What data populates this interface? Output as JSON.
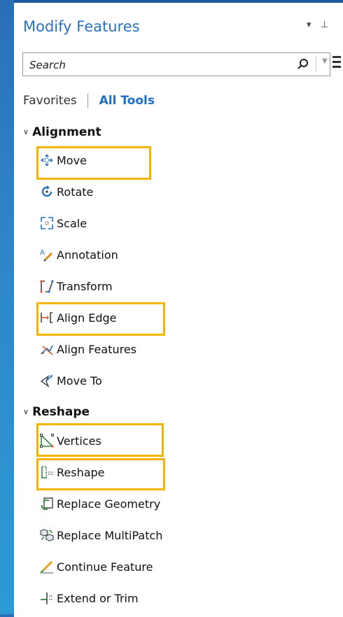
{
  "header": {
    "title": "Modify Features",
    "dropdown_glyph": "▾",
    "pin_glyph": "⊥"
  },
  "search": {
    "placeholder": "Search",
    "icon": "search-icon"
  },
  "tabs": {
    "favorites": "Favorites",
    "all_tools": "All Tools"
  },
  "groups": {
    "alignment": {
      "label": "Alignment",
      "tools": [
        {
          "label": "Move",
          "icon": "move-icon",
          "highlighted": true
        },
        {
          "label": "Rotate",
          "icon": "rotate-icon",
          "highlighted": false
        },
        {
          "label": "Scale",
          "icon": "scale-icon",
          "highlighted": false
        },
        {
          "label": "Annotation",
          "icon": "annotation-icon",
          "highlighted": false
        },
        {
          "label": "Transform",
          "icon": "transform-icon",
          "highlighted": false
        },
        {
          "label": "Align Edge",
          "icon": "align-edge-icon",
          "highlighted": true
        },
        {
          "label": "Align Features",
          "icon": "align-features-icon",
          "highlighted": false
        },
        {
          "label": "Move To",
          "icon": "move-to-icon",
          "highlighted": false
        }
      ]
    },
    "reshape": {
      "label": "Reshape",
      "tools": [
        {
          "label": "Vertices",
          "icon": "vertices-icon",
          "highlighted": true
        },
        {
          "label": "Reshape",
          "icon": "reshape-icon",
          "highlighted": true
        },
        {
          "label": "Replace Geometry",
          "icon": "replace-geometry-icon",
          "highlighted": false
        },
        {
          "label": "Replace MultiPatch",
          "icon": "replace-multipatch-icon",
          "highlighted": false
        },
        {
          "label": "Continue Feature",
          "icon": "continue-feature-icon",
          "highlighted": false
        },
        {
          "label": "Extend or Trim",
          "icon": "extend-trim-icon",
          "highlighted": false
        }
      ]
    }
  },
  "colors": {
    "accent": "#2a72c3",
    "highlight": "#f4b400",
    "background": "#2f86c8"
  }
}
